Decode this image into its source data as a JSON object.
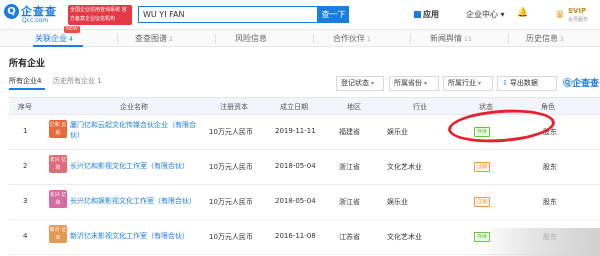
{
  "header": {
    "logo_glyph": "Q",
    "logo_name": "企查查",
    "logo_domain": "Qcc.com",
    "slogan": "全国企业信用查询系统 官方备案企业征信机构",
    "search_value": "WU YI FAN",
    "search_button": "查一下",
    "apps_label": "应用",
    "center_label": "企业中心",
    "vip_label": "SVIP",
    "vip_sub": "会员服务"
  },
  "tabs": [
    {
      "label": "关联企业",
      "count": "4"
    },
    {
      "label": "查查图谱",
      "count": "2"
    },
    {
      "label": "风险信息",
      "count": ""
    },
    {
      "label": "合作伙伴",
      "count": "1"
    },
    {
      "label": "新闻舆情",
      "count": "15"
    },
    {
      "label": "历史信息",
      "count": "3"
    }
  ],
  "hot_badge": "NEW",
  "section": {
    "title": "所有企业",
    "subtabs": [
      {
        "label": "所有企业",
        "count": "4"
      },
      {
        "label": "历史所有企业",
        "count": "1"
      }
    ]
  },
  "filters": {
    "status": "登记状态",
    "province": "所属省份",
    "industry": "所属行业",
    "export": "导出数据",
    "brand": "企查查"
  },
  "table": {
    "headers": [
      "序号",
      "企业名称",
      "注册资本",
      "成立日期",
      "地区",
      "行业",
      "状态",
      "角色"
    ],
    "rows": [
      {
        "idx": "1",
        "logo": "亿和 云起",
        "logo_color": "#e8693c",
        "name": "厦门亿和云起文化传媒合伙企业（有限合伙）",
        "capital": "10万元人民币",
        "date": "2019-11-11",
        "region": "福建省",
        "industry": "娱乐业",
        "status": "存续",
        "status_kind": "ok",
        "role": "股东"
      },
      {
        "idx": "2",
        "logo": "长兴 亿和",
        "logo_color": "#e06b7a",
        "name": "长兴亿和影视文化工作室（有限合伙）",
        "capital": "10万元人民币",
        "date": "2018-05-04",
        "region": "浙江省",
        "industry": "文化艺术业",
        "status": "注销",
        "status_kind": "cancel",
        "role": "股东"
      },
      {
        "idx": "3",
        "logo": "长兴 亿和",
        "logo_color": "#d96ba1",
        "name": "长兴亿和娱影视文化工作室（有限合伙）",
        "capital": "10万元人民币",
        "date": "2018-05-04",
        "region": "浙江省",
        "industry": "娱乐业",
        "status": "注销",
        "status_kind": "cancel",
        "role": "股东"
      },
      {
        "idx": "4",
        "logo": "新沂 亿末",
        "logo_color": "#e49a52",
        "name": "新沂亿末影视文化工作室（有限合伙）",
        "capital": "10万元人民币",
        "date": "2016-11-08",
        "region": "江苏省",
        "industry": "文化艺术业",
        "status": "存续",
        "status_kind": "ok",
        "role": "股东"
      }
    ]
  }
}
